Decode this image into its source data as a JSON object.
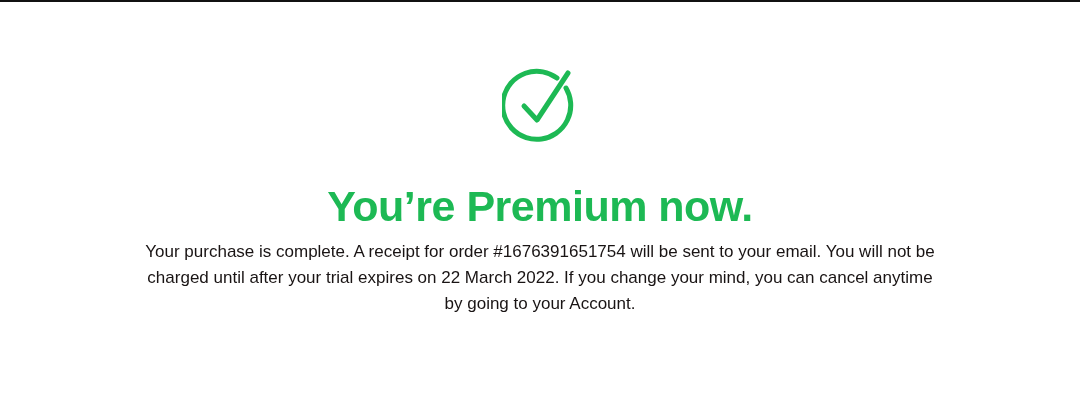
{
  "title": "You’re Premium now.",
  "message": "Your purchase is complete. A receipt for order #1676391651754 will be sent to your email. You will not be charged until after your trial expires on 22 March 2022. If you change your mind, you can cancel anytime by going to your Account."
}
